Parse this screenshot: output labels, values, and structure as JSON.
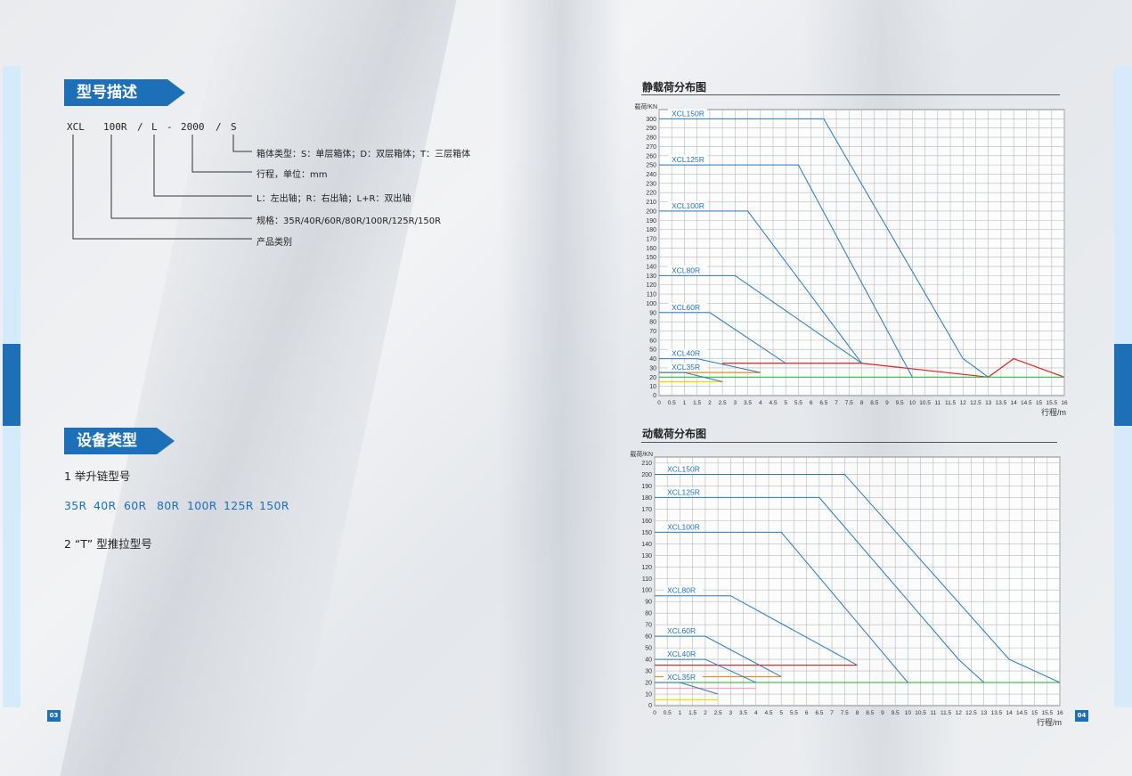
{
  "left_page": {
    "model_desc": {
      "heading": "型号描述",
      "code_tokens": [
        "XCL",
        "100R",
        "/",
        "L",
        "-",
        "2000",
        "/",
        "S"
      ],
      "descriptions": [
        "箱体类型：S：单层箱体；D：双层箱体；T：三层箱体",
        "行程，单位：mm",
        "L：左出轴；R：右出轴；L+R：双出轴",
        "规格：35R/40R/60R/80R/100R/125R/150R",
        "产品类别"
      ]
    },
    "equipment": {
      "heading": "设备类型",
      "item1": "1 举升链型号",
      "models": [
        "35R",
        "40R",
        "60R",
        "80R",
        "100R",
        "125R",
        "150R"
      ],
      "item2": "2 “T” 型推拉型号"
    },
    "page_number": "03"
  },
  "right_page": {
    "page_number": "04"
  },
  "colors": {
    "accent": "#1d6fb8",
    "line": "#2a78bd",
    "red": "#e02020",
    "orange": "#f08a1c",
    "green": "#3cb44b",
    "pink": "#f4a6c0",
    "yellow": "#e8e000"
  },
  "chart_data": [
    {
      "type": "line",
      "title": "静载荷分布图",
      "ylabel": "载荷/KN",
      "xlabel": "行程/m",
      "xlim": [
        0,
        16
      ],
      "ylim": [
        0,
        310
      ],
      "x_ticks": [
        "0",
        "0.5",
        "1",
        "1.5",
        "2",
        "2.5",
        "3",
        "3.5",
        "4",
        "4.5",
        "5",
        "5.5",
        "6",
        "6.5",
        "7",
        "7.5",
        "8",
        "8.5",
        "9",
        "9.5",
        "10",
        "10.5",
        "11",
        "11.5",
        "12",
        "12.5",
        "13",
        "13.5",
        "14",
        "14.5",
        "15",
        "15.5",
        "16"
      ],
      "y_ticks": [
        10,
        20,
        30,
        40,
        50,
        60,
        70,
        80,
        90,
        100,
        110,
        120,
        130,
        140,
        150,
        160,
        170,
        180,
        190,
        200,
        210,
        220,
        230,
        240,
        250,
        260,
        270,
        280,
        290,
        300
      ],
      "series": [
        {
          "name": "XCL150R",
          "points": [
            [
              0,
              300
            ],
            [
              6.5,
              300
            ],
            [
              12,
              40
            ],
            [
              13,
              20
            ]
          ]
        },
        {
          "name": "XCL125R",
          "points": [
            [
              0,
              250
            ],
            [
              5.5,
              250
            ],
            [
              10,
              20
            ]
          ]
        },
        {
          "name": "XCL100R",
          "points": [
            [
              0,
              200
            ],
            [
              3.5,
              200
            ],
            [
              8,
              35
            ]
          ]
        },
        {
          "name": "XCL80R",
          "points": [
            [
              0,
              130
            ],
            [
              3,
              130
            ],
            [
              8,
              35
            ]
          ]
        },
        {
          "name": "XCL60R",
          "points": [
            [
              0,
              90
            ],
            [
              2,
              90
            ],
            [
              5,
              35
            ]
          ]
        },
        {
          "name": "XCL40R",
          "points": [
            [
              0,
              40
            ],
            [
              1.5,
              40
            ],
            [
              4,
              25
            ]
          ]
        },
        {
          "name": "XCL35R",
          "points": [
            [
              0,
              25
            ],
            [
              1,
              25
            ],
            [
              2.5,
              15
            ]
          ]
        }
      ],
      "extra_lines": [
        {
          "color": "#e02020",
          "points": [
            [
              2.5,
              35
            ],
            [
              8,
              35
            ],
            [
              13,
              20
            ],
            [
              14,
              40
            ],
            [
              16,
              20
            ]
          ]
        },
        {
          "color": "#f08a1c",
          "points": [
            [
              0,
              25
            ],
            [
              4,
              25
            ]
          ]
        },
        {
          "color": "#3cb44b",
          "points": [
            [
              0,
              20
            ],
            [
              16,
              20
            ]
          ]
        },
        {
          "color": "#f4a6c0",
          "points": [
            [
              0,
              15
            ],
            [
              2,
              15
            ]
          ]
        },
        {
          "color": "#e8e000",
          "points": [
            [
              0,
              15
            ],
            [
              2.5,
              15
            ]
          ]
        }
      ]
    },
    {
      "type": "line",
      "title": "动载荷分布图",
      "ylabel": "载荷/KN",
      "xlabel": "行程/m",
      "xlim": [
        0,
        16
      ],
      "ylim": [
        0,
        215
      ],
      "x_ticks": [
        "0",
        "0.5",
        "1",
        "1.5",
        "2",
        "2.5",
        "3",
        "3.5",
        "4",
        "4.5",
        "5",
        "5.5",
        "6",
        "6.5",
        "7",
        "7.5",
        "8",
        "8.5",
        "9",
        "9.5",
        "10",
        "10.5",
        "11",
        "11.5",
        "12",
        "12.5",
        "13",
        "13.5",
        "14",
        "14.5",
        "15",
        "15.5",
        "16"
      ],
      "y_ticks": [
        10,
        20,
        30,
        40,
        50,
        60,
        70,
        80,
        90,
        100,
        110,
        120,
        130,
        140,
        150,
        160,
        170,
        180,
        190,
        200,
        210
      ],
      "series": [
        {
          "name": "XCL150R",
          "points": [
            [
              0,
              200
            ],
            [
              7.5,
              200
            ],
            [
              14,
              40
            ],
            [
              16,
              20
            ]
          ]
        },
        {
          "name": "XCL125R",
          "points": [
            [
              0,
              180
            ],
            [
              6.5,
              180
            ],
            [
              12,
              40
            ],
            [
              13,
              20
            ]
          ]
        },
        {
          "name": "XCL100R",
          "points": [
            [
              0,
              150
            ],
            [
              5,
              150
            ],
            [
              10,
              20
            ]
          ]
        },
        {
          "name": "XCL80R",
          "points": [
            [
              0,
              95
            ],
            [
              3,
              95
            ],
            [
              8,
              35
            ]
          ]
        },
        {
          "name": "XCL60R",
          "points": [
            [
              0,
              60
            ],
            [
              2,
              60
            ],
            [
              5,
              25
            ]
          ]
        },
        {
          "name": "XCL40R",
          "points": [
            [
              0,
              40
            ],
            [
              2,
              40
            ],
            [
              4,
              20
            ]
          ]
        },
        {
          "name": "XCL35R",
          "points": [
            [
              0,
              20
            ],
            [
              1,
              20
            ],
            [
              2.5,
              10
            ]
          ]
        }
      ],
      "extra_lines": [
        {
          "color": "#e02020",
          "points": [
            [
              0,
              35
            ],
            [
              8,
              35
            ]
          ]
        },
        {
          "color": "#f08a1c",
          "points": [
            [
              0,
              25
            ],
            [
              5,
              25
            ]
          ]
        },
        {
          "color": "#3cb44b",
          "points": [
            [
              0,
              20
            ],
            [
              16,
              20
            ]
          ]
        },
        {
          "color": "#f4a6c0",
          "points": [
            [
              0,
              15
            ],
            [
              4,
              15
            ]
          ]
        },
        {
          "color": "#e8e000",
          "points": [
            [
              0,
              5
            ],
            [
              2.5,
              5
            ]
          ]
        }
      ]
    }
  ]
}
